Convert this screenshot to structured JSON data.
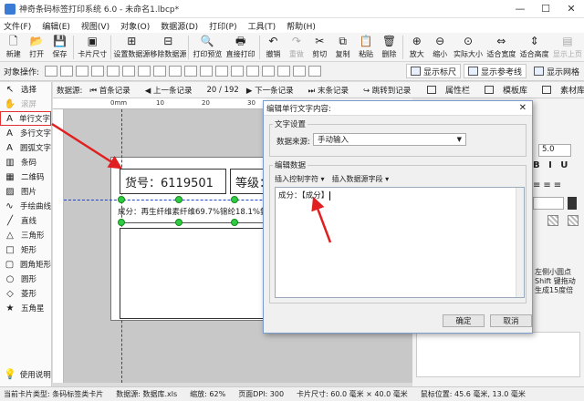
{
  "window": {
    "title": "神奇条码标签打印系统 6.0 - 未命名1.lbcp*",
    "controls": [
      "—",
      "☐",
      "✕"
    ]
  },
  "menu": [
    "文件(F)",
    "编辑(E)",
    "视图(V)",
    "对象(O)",
    "数据源(D)",
    "打印(P)",
    "工具(T)",
    "帮助(H)"
  ],
  "toolbar": [
    {
      "icon": "new-icon",
      "glyph": "🗋",
      "label": "新建"
    },
    {
      "icon": "open-icon",
      "glyph": "📂",
      "label": "打开"
    },
    {
      "icon": "save-icon",
      "glyph": "💾",
      "label": "保存"
    },
    {
      "sep": true
    },
    {
      "icon": "card-size-icon",
      "glyph": "▣",
      "label": "卡片尺寸"
    },
    {
      "sep": true
    },
    {
      "icon": "set-datasource-icon",
      "glyph": "⊞",
      "label": "设置数据源"
    },
    {
      "icon": "remove-datasource-icon",
      "glyph": "⊟",
      "label": "移除数据源"
    },
    {
      "sep": true
    },
    {
      "icon": "print-preview-icon",
      "glyph": "🔍",
      "label": "打印预览"
    },
    {
      "icon": "direct-print-icon",
      "glyph": "🖶",
      "label": "直接打印"
    },
    {
      "sep": true
    },
    {
      "icon": "undo-icon",
      "glyph": "↶",
      "label": "撤销"
    },
    {
      "icon": "redo-icon",
      "glyph": "↷",
      "label": "重做",
      "disabled": true
    },
    {
      "icon": "cut-icon",
      "glyph": "✂",
      "label": "剪切"
    },
    {
      "icon": "copy-icon",
      "glyph": "⧉",
      "label": "复制"
    },
    {
      "icon": "paste-icon",
      "glyph": "📋",
      "label": "粘贴"
    },
    {
      "icon": "delete-icon",
      "glyph": "🗑",
      "label": "删除"
    },
    {
      "sep": true
    },
    {
      "icon": "zoom-in-icon",
      "glyph": "⊕",
      "label": "放大"
    },
    {
      "icon": "zoom-out-icon",
      "glyph": "⊖",
      "label": "缩小"
    },
    {
      "icon": "actual-size-icon",
      "glyph": "⊙",
      "label": "实际大小"
    },
    {
      "icon": "fit-width-icon",
      "glyph": "⇔",
      "label": "适合宽度"
    },
    {
      "icon": "fit-height-icon",
      "glyph": "⇕",
      "label": "适合高度"
    },
    {
      "icon": "prev-page-icon",
      "glyph": "▤",
      "label": "显示上页",
      "disabled": true
    }
  ],
  "ops": {
    "label": "对象操作:",
    "show_ruler": "显示标尺",
    "show_guides": "显示参考线",
    "show_grid": "显示网格"
  },
  "tools": [
    {
      "icon": "cursor-icon",
      "glyph": "↖",
      "label": "选择"
    },
    {
      "icon": "hand-icon",
      "glyph": "✋",
      "label": "滚屏",
      "disabled": true
    },
    {
      "icon": "single-text-icon",
      "glyph": "A",
      "label": "单行文字",
      "active": true
    },
    {
      "icon": "multi-text-icon",
      "glyph": "A",
      "label": "多行文字"
    },
    {
      "icon": "arc-text-icon",
      "glyph": "A",
      "label": "圆弧文字"
    },
    {
      "icon": "barcode-icon",
      "glyph": "▥",
      "label": "条码"
    },
    {
      "icon": "qrcode-icon",
      "glyph": "▦",
      "label": "二维码"
    },
    {
      "icon": "image-icon",
      "glyph": "▨",
      "label": "图片"
    },
    {
      "icon": "freehand-icon",
      "glyph": "∿",
      "label": "手绘曲线"
    },
    {
      "icon": "line-icon",
      "glyph": "╱",
      "label": "直线"
    },
    {
      "icon": "triangle-icon",
      "glyph": "△",
      "label": "三角形"
    },
    {
      "icon": "rectangle-icon",
      "glyph": "□",
      "label": "矩形"
    },
    {
      "icon": "rounded-rect-icon",
      "glyph": "▢",
      "label": "圆角矩形"
    },
    {
      "icon": "circle-icon",
      "glyph": "○",
      "label": "圆形"
    },
    {
      "icon": "diamond-icon",
      "glyph": "◇",
      "label": "菱形"
    },
    {
      "icon": "star-icon",
      "glyph": "★",
      "label": "五角星"
    }
  ],
  "help": {
    "label": "使用说明"
  },
  "records": {
    "label": "数据源:",
    "first": "首条记录",
    "prev": "上一条记录",
    "position": "20 / 192",
    "next": "下一条记录",
    "last": "末条记录",
    "jump": "跳转到记录"
  },
  "ruler_marks": [
    "0mm",
    "10",
    "20",
    "30"
  ],
  "label_design": {
    "item_no": "货号：6119501",
    "grade": "等级：",
    "composition": "成分：再生纤维素纤维69.7%锦纶18.1%氨"
  },
  "right_panel": {
    "tabs": [
      "属性栏",
      "模板库",
      "素材库"
    ],
    "font_size": "5.0",
    "hint_lines": [
      "左侧小圆点",
      "Shift 键拖动",
      "生成15度倍"
    ]
  },
  "dialog": {
    "title": "编辑单行文字内容:",
    "close": "✕",
    "text_settings": "文字设置",
    "source_label": "数据来源:",
    "source_value": "手动输入",
    "edit_data": "编辑数据",
    "insert_control": "插入控制字符",
    "insert_field": "插入数据源字段",
    "content": "成分：【成分】",
    "ok": "确定",
    "cancel": "取消"
  },
  "status": {
    "card_type": "当前卡片类型: 条码标签类卡片",
    "datasource": "数据源: 数据库.xls",
    "zoom": "缩放: 62%",
    "dpi": "页面DPI: 300",
    "card_size": "卡片尺寸: 60.0 毫米 × 40.0 毫米",
    "mouse_pos": "鼠标位置: 45.6 毫米, 13.0 毫米"
  }
}
